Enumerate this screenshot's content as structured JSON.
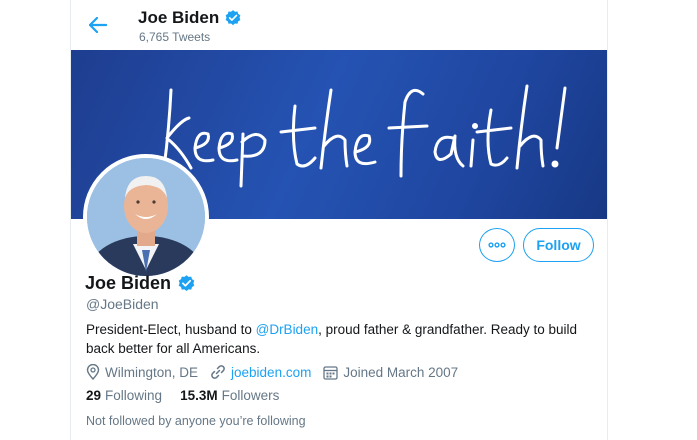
{
  "header": {
    "name": "Joe Biden",
    "tweet_count": "6,765 Tweets"
  },
  "banner": {
    "text": "keep the faith!"
  },
  "actions": {
    "follow_label": "Follow"
  },
  "profile": {
    "name": "Joe Biden",
    "handle": "@JoeBiden",
    "bio_before": "President-Elect, husband to ",
    "bio_mention": "@DrBiden",
    "bio_after": ", proud father & grandfather. Ready to build back better for all Americans.",
    "location": "Wilmington, DE",
    "website": "joebiden.com",
    "joined": "Joined March 2007",
    "following_count": "29",
    "following_label": "Following",
    "followers_count": "15.3M",
    "followers_label": "Followers",
    "followed_note": "Not followed by anyone you’re following"
  },
  "colors": {
    "accent": "#1da1f2",
    "secondary_text": "#657786",
    "banner": "#2553b3"
  },
  "icons": [
    "back-arrow-icon",
    "verified-badge-icon",
    "more-dots-icon",
    "location-pin-icon",
    "link-icon",
    "calendar-icon"
  ]
}
